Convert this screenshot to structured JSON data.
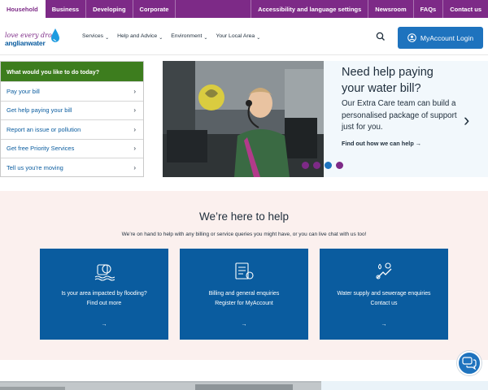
{
  "topbar": {
    "tabs": [
      "Household",
      "Business",
      "Developing",
      "Corporate"
    ],
    "utility": [
      "Accessibility and language settings",
      "Newsroom",
      "FAQs",
      "Contact us"
    ]
  },
  "header": {
    "logo_line1": "love every drop",
    "logo_line2": "anglianwater",
    "nav": [
      "Services",
      "Help and Advice",
      "Environment",
      "Your Local Area"
    ],
    "myaccount_label": "MyAccount Login"
  },
  "quick_links": {
    "title": "What would you like to do today?",
    "items": [
      "Pay your bill",
      "Get help paying your bill",
      "Report an issue or pollution",
      "Get free Priority Services",
      "Tell us you're moving"
    ]
  },
  "hero": {
    "title_line1": "Need help paying",
    "title_line2": "your water bill?",
    "description": "Our Extra Care team can build a personalised package of support just for you.",
    "link": "Find out how we can help →",
    "dot_colors": [
      "#7d2a87",
      "#7d2a87",
      "#1e73be",
      "#7d2a87"
    ]
  },
  "help_section": {
    "title": "We’re here to help",
    "subtitle": "We’re on hand to help with any billing or service queries you might have, or you can live chat with us too!",
    "cards": [
      {
        "title": "Is your area impacted by flooding?",
        "link": "Find out more",
        "arrow": "→",
        "icon": "flood-icon"
      },
      {
        "title": "Billing and general enquiries",
        "link": "Register for MyAccount",
        "arrow": "→",
        "icon": "bill-icon"
      },
      {
        "title": "Water supply and sewerage enquiries",
        "link": "Contact us",
        "arrow": "→",
        "icon": "pipe-icon"
      }
    ]
  },
  "colors": {
    "brand_purple": "#7d2a87",
    "brand_blue": "#0a5c9f",
    "green": "#3d7d1e",
    "help_bg": "#fbf0ee"
  }
}
